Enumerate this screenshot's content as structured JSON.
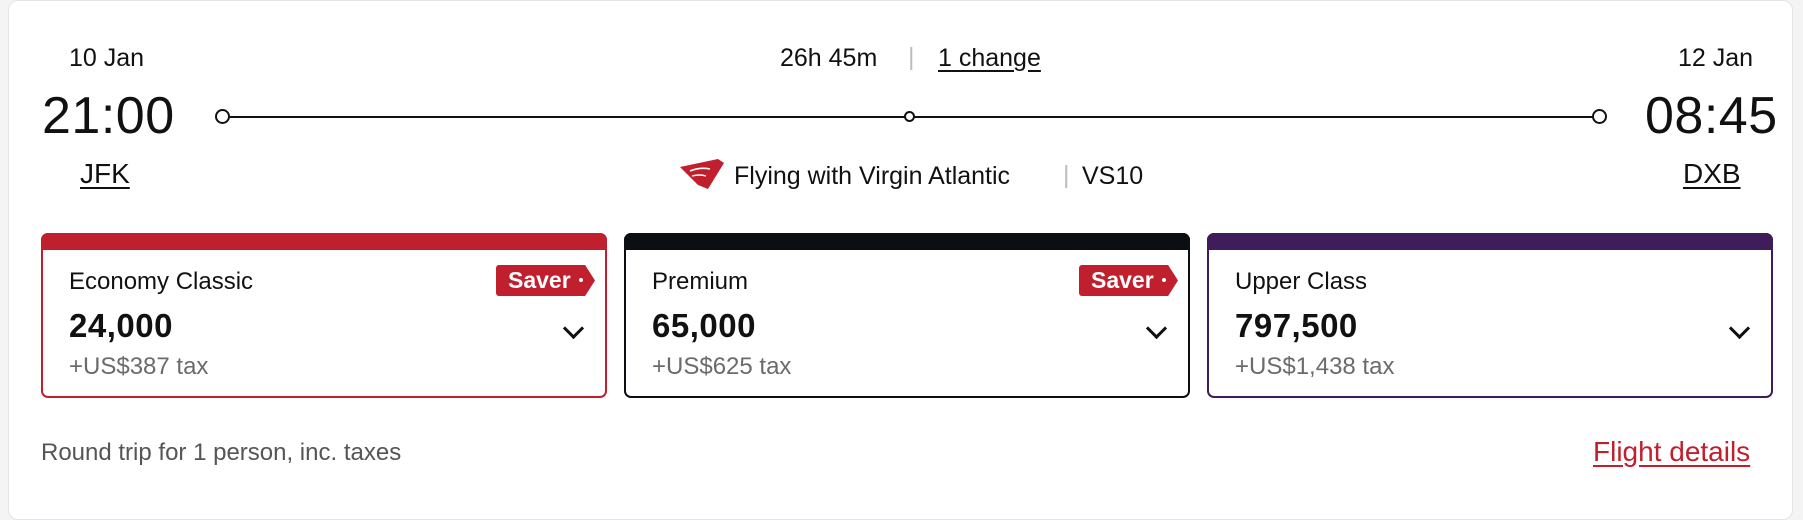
{
  "flight": {
    "departure": {
      "date": "10 Jan",
      "time": "21:00",
      "airport": "JFK"
    },
    "arrival": {
      "date": "12 Jan",
      "time": "08:45",
      "airport": "DXB"
    },
    "duration": "26h 45m",
    "separator": "|",
    "stops_link": "1 change",
    "operator": "Flying with Virgin Atlantic",
    "flight_number": "VS10",
    "logo_icon": "virgin-atlantic-logo"
  },
  "fares": [
    {
      "name": "Economy Classic",
      "points": "24,000",
      "tax": "+US$387 tax",
      "badge": "Saver",
      "accent": "#c0202e"
    },
    {
      "name": "Premium",
      "points": "65,000",
      "tax": "+US$625 tax",
      "badge": "Saver",
      "accent": "#0b0e12"
    },
    {
      "name": "Upper Class",
      "points": "797,500",
      "tax": "+US$1,438 tax",
      "badge": "",
      "accent": "#3f1d5a"
    }
  ],
  "footer": {
    "note": "Round trip for 1 person, inc. taxes",
    "details_link": "Flight details"
  },
  "colors": {
    "brand_red": "#c0202e",
    "premium_black": "#0b0e12",
    "upper_purple": "#3f1d5a",
    "muted_text": "#6b6b6b"
  }
}
